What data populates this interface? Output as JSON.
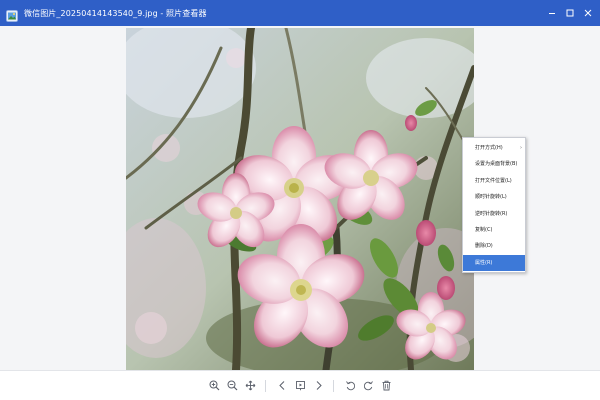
{
  "window": {
    "title": "微信图片_20250414143540_9.jpg - 照片查看器",
    "accent_color": "#2f5fc7",
    "controls": [
      {
        "name": "minimize-icon"
      },
      {
        "name": "maximize-icon"
      },
      {
        "name": "close-icon"
      }
    ]
  },
  "photo": {
    "subject": "pink and white apple blossoms on a tree branch",
    "alt": "微信图片_20250414143540_9.jpg"
  },
  "context_menu": {
    "items": [
      {
        "label": "打开方式(H)",
        "has_submenu": true
      },
      {
        "label": "设置为桌面背景(B)"
      },
      {
        "label": "打开文件位置(L)"
      },
      {
        "label": "顺时针旋转(L)"
      },
      {
        "label": "逆时针旋转(R)"
      },
      {
        "label": "复制(C)"
      },
      {
        "label": "删除(D)"
      },
      {
        "label": "属性(R)",
        "selected": true
      }
    ],
    "submenu_arrow": "›"
  },
  "toolbar": {
    "buttons": [
      {
        "icon": "zoom-in-icon"
      },
      {
        "icon": "zoom-out-icon"
      },
      {
        "icon": "fit-screen-icon"
      },
      {
        "icon": "previous-icon"
      },
      {
        "icon": "slideshow-icon"
      },
      {
        "icon": "next-icon"
      },
      {
        "icon": "rotate-left-icon"
      },
      {
        "icon": "rotate-right-icon"
      },
      {
        "icon": "delete-icon"
      }
    ]
  }
}
